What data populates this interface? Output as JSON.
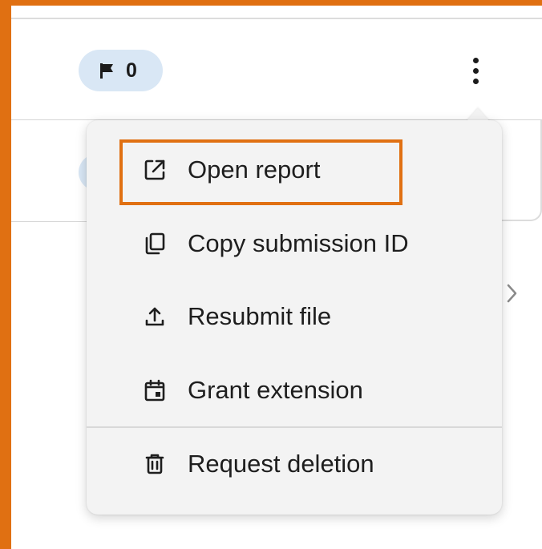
{
  "row": {
    "flag_count": "0"
  },
  "menu": {
    "items": [
      {
        "label": "Open report",
        "icon": "external-link-icon"
      },
      {
        "label": "Copy submission ID",
        "icon": "copy-icon"
      },
      {
        "label": "Resubmit file",
        "icon": "upload-icon"
      },
      {
        "label": "Grant extension",
        "icon": "calendar-icon"
      },
      {
        "label": "Request deletion",
        "icon": "trash-icon"
      }
    ]
  },
  "colors": {
    "highlight": "#e07012",
    "badge_bg": "#d9e7f5",
    "menu_bg": "#f3f3f3"
  }
}
